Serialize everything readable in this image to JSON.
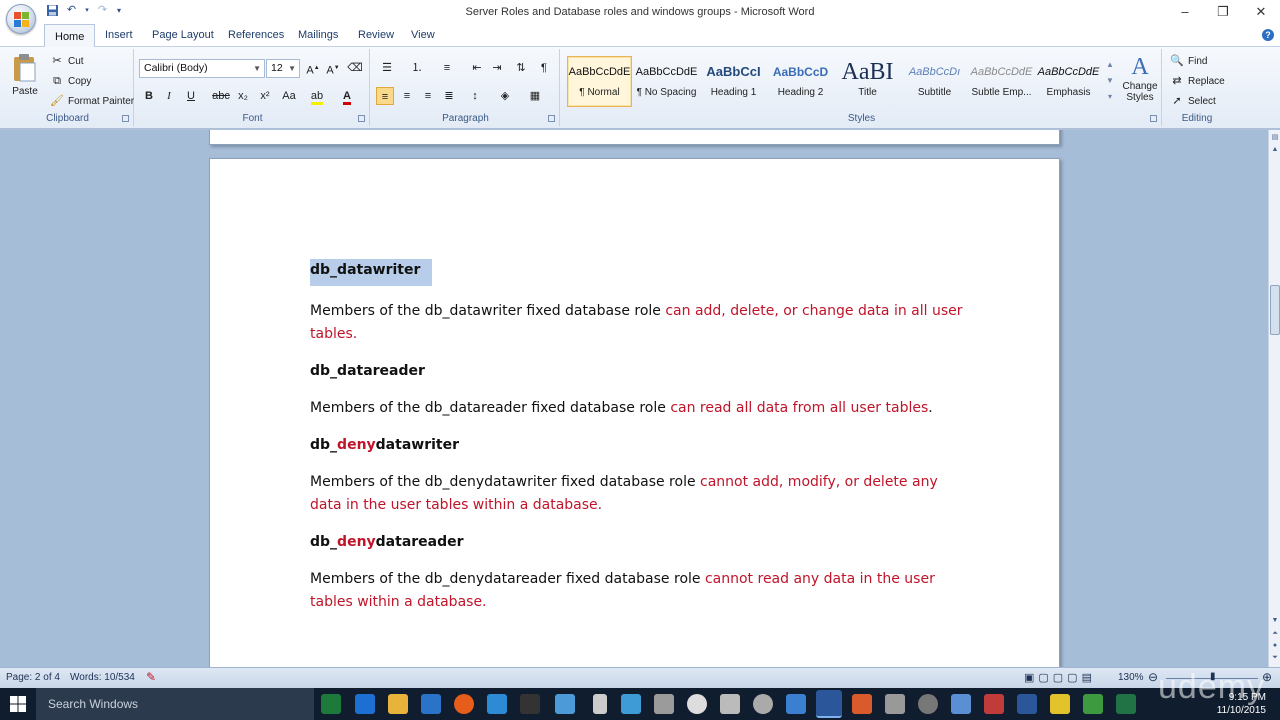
{
  "window": {
    "title": "Server Roles and Database roles and windows groups - Microsoft Word",
    "controls": [
      "–",
      "❐",
      "✕"
    ]
  },
  "quick_access": {
    "save": "save-icon",
    "undo": "undo-icon",
    "redo": "redo-icon",
    "customize": "▾"
  },
  "tabs": [
    "Home",
    "Insert",
    "Page Layout",
    "References",
    "Mailings",
    "Review",
    "View"
  ],
  "active_tab": "Home",
  "clipboard": {
    "paste": "Paste",
    "cut": "Cut",
    "copy": "Copy",
    "format_painter": "Format Painter",
    "label": "Clipboard"
  },
  "font": {
    "name": "Calibri (Body)",
    "size": "12",
    "label": "Font"
  },
  "paragraph": {
    "label": "Paragraph"
  },
  "styles": {
    "label": "Styles",
    "items": [
      {
        "sample": "AaBbCcDdE",
        "name": "¶ Normal"
      },
      {
        "sample": "AaBbCcDdE",
        "name": "¶ No Spacing"
      },
      {
        "sample": "AaBbCcI",
        "name": "Heading 1"
      },
      {
        "sample": "AaBbCcD",
        "name": "Heading 2"
      },
      {
        "sample": "AaBI",
        "name": "Title"
      },
      {
        "sample": "AaBbCcDı",
        "name": "Subtitle"
      },
      {
        "sample": "AaBbCcDdE",
        "name": "Subtle Emp..."
      },
      {
        "sample": "AaBbCcDdE",
        "name": "Emphasis"
      }
    ],
    "change_styles": "Change Styles"
  },
  "editing": {
    "find": "Find",
    "replace": "Replace",
    "select": "Select",
    "label": "Editing"
  },
  "document": {
    "sections": [
      {
        "h1": "db_datawriter",
        "p_black": "Members of the db_datawriter fixed database role ",
        "p_red": "can add, delete, or change data in all user tables."
      },
      {
        "h1": "db_datareader",
        "p_black": "Members of the db_datareader fixed database role ",
        "p_red": "can read all data from all user tables",
        "p_tail": "."
      },
      {
        "h1a": "db_",
        "h1b": "deny",
        "h1c": "datawriter",
        "p_black": "Members of the db_denydatawriter fixed database role ",
        "p_red": "cannot add, modify, or delete any data in the user tables within a database."
      },
      {
        "h1a": "db_",
        "h1b": "deny",
        "h1c": "datareader",
        "p_black": "Members of the db_denydatareader fixed database role ",
        "p_red": "cannot read any data in the user tables within a database."
      }
    ]
  },
  "status": {
    "page": "Page: 2 of 4",
    "words": "Words: 10/534",
    "zoom": "130%"
  },
  "taskbar": {
    "search": "Search Windows",
    "time": "9:15 PM",
    "date": "11/10/2015"
  },
  "watermark": "udemy",
  "colors": {
    "accent_red": "#c0142a",
    "ribbon_blue": "#3b5a86",
    "selection": "#b8cde9"
  }
}
